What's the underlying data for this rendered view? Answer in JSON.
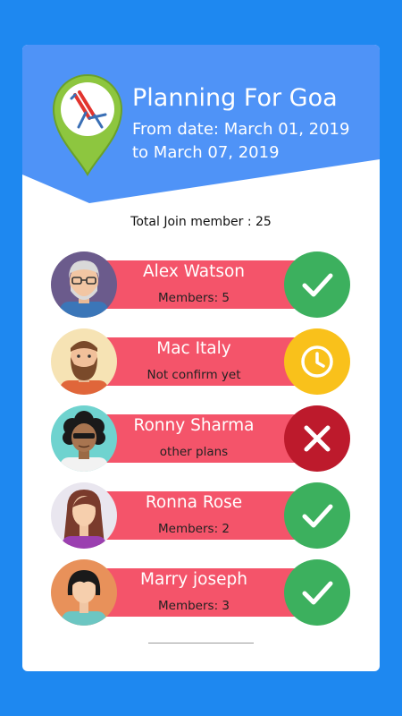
{
  "header": {
    "title": "Planning For Goa",
    "from_date": "From date: March 01, 2019",
    "to_date": "to March 07, 2019"
  },
  "summary": {
    "total_label": "Total Join member : 25"
  },
  "colors": {
    "background": "#1e88f0",
    "header_blue": "#4f93f7",
    "pill": "#f4546a",
    "confirmed": "#3cb05e",
    "pending": "#f9c11b",
    "declined": "#bd1a2c",
    "pin_green": "#8dc63f"
  },
  "members": [
    {
      "name": "Alex Watson",
      "status": "Members: 5",
      "state": "confirmed",
      "icon": "check-icon",
      "avatar": "grey-haired-man-glasses"
    },
    {
      "name": "Mac Italy",
      "status": "Not confirm yet",
      "state": "pending",
      "icon": "clock-icon",
      "avatar": "bearded-man"
    },
    {
      "name": "Ronny Sharma",
      "status": "other plans",
      "state": "declined",
      "icon": "cross-icon",
      "avatar": "curly-hair-man-sunglasses"
    },
    {
      "name": "Ronna Rose",
      "status": "Members: 2",
      "state": "confirmed",
      "icon": "check-icon",
      "avatar": "long-hair-woman"
    },
    {
      "name": "Marry joseph",
      "status": "Members: 3",
      "state": "confirmed",
      "icon": "check-icon",
      "avatar": "bob-hair-woman"
    }
  ]
}
